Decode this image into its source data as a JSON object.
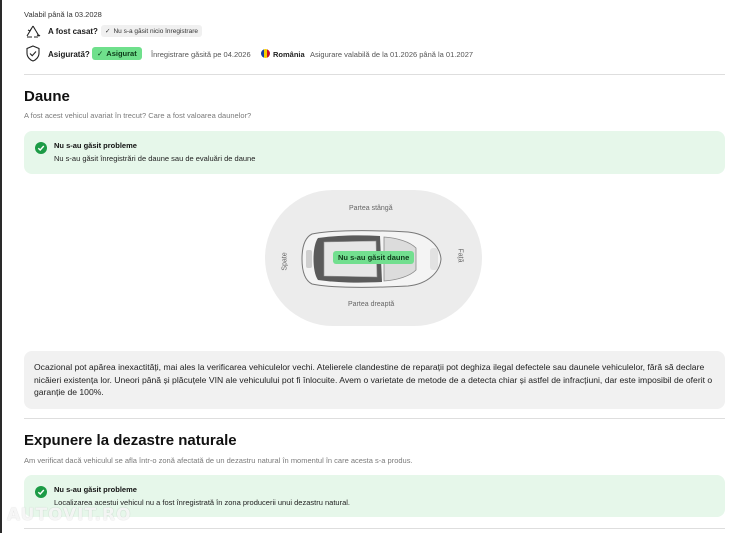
{
  "top": {
    "valid_until": "Valabil până la 03.2028",
    "crashed": {
      "label": "A fost casat?",
      "chip": "Nu s-a găsit nicio înregistrare"
    },
    "insured": {
      "label": "Asigurată?",
      "chip": "Asigurat",
      "found": "Înregistrare găsită pe 04.2026",
      "country": "România",
      "valid": "Asigurare valabilă de la 01.2026 până la 01.2027"
    }
  },
  "damage": {
    "title": "Daune",
    "subtitle": "A fost acest vehicul avariat în trecut? Care a fost valoarea daunelor?",
    "status_title": "Nu s-au găsit probleme",
    "status_text": "Nu s-au găsit înregistrări de daune sau de evaluări de daune",
    "diagram": {
      "left_side": "Partea stângă",
      "right_side": "Partea dreaptă",
      "rear": "Spate",
      "front": "Față",
      "center_label": "Nu s-au găsit daune"
    },
    "disclaimer": "Ocazional pot apărea inexactități, mai ales la verificarea vehiculelor vechi. Atelierele clandestine de reparații pot deghiza ilegal defectele sau daunele vehiculelor, fără să declare nicăieri existența lor. Uneori până și plăcuțele VIN ale vehiculului pot fi înlocuite. Avem o varietate de metode de a detecta chiar și astfel de infracțiuni, dar este imposibil de oferit o garanție de 100%."
  },
  "disaster": {
    "title": "Expunere la dezastre naturale",
    "subtitle": "Am verificat dacă vehiculul se afla într-o zonă afectată de un dezastru natural în momentul în care acesta s-a produs.",
    "status_title": "Nu s-au găsit probleme",
    "status_text": "Localizarea acestui vehicul nu a fost înregistrată în zona producerii unui dezastru natural."
  },
  "watermark": "AUTOVIT.RO",
  "colors": {
    "accent_green": "#6fe08c",
    "ok_green": "#1c9b46",
    "success_bg": "#e6f7ea",
    "neutral_bg": "#f1f1f1"
  }
}
